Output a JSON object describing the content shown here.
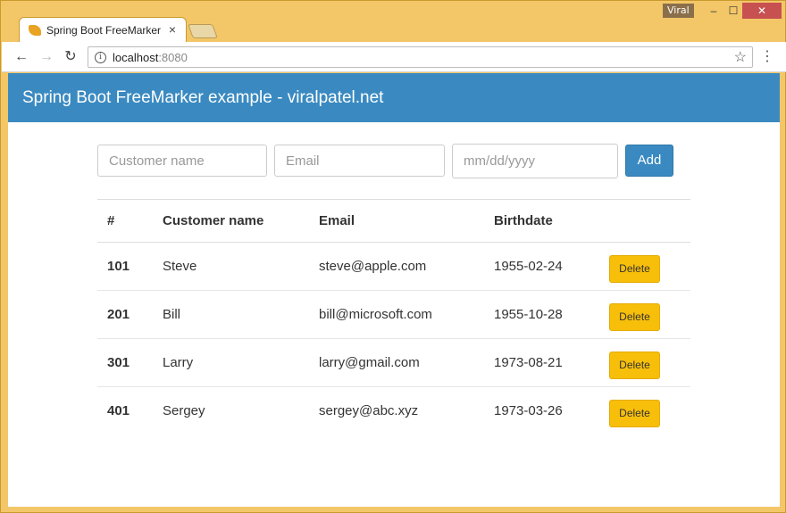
{
  "browser": {
    "profile_name": "Viral",
    "tab_title": "Spring Boot FreeMarker",
    "tab_close": "×",
    "url_host": "localhost",
    "url_port": ":8080",
    "window_controls": {
      "minimize": "‒",
      "maximize": "☐",
      "close": "✕"
    },
    "nav": {
      "back": "←",
      "forward": "→",
      "reload": "↻"
    },
    "star": "☆",
    "menu": "⋮",
    "info": "i"
  },
  "header": {
    "title": "Spring Boot FreeMarker example - viralpatel.net",
    "color": "#3a8ac1"
  },
  "form": {
    "name_placeholder": "Customer name",
    "email_placeholder": "Email",
    "date_placeholder": "mm/dd/yyyy",
    "add_label": "Add"
  },
  "table": {
    "columns": [
      "#",
      "Customer name",
      "Email",
      "Birthdate"
    ],
    "rows": [
      {
        "id": "101",
        "name": "Steve",
        "email": "steve@apple.com",
        "birthdate": "1955-02-24",
        "action": "Delete"
      },
      {
        "id": "201",
        "name": "Bill",
        "email": "bill@microsoft.com",
        "birthdate": "1955-10-28",
        "action": "Delete"
      },
      {
        "id": "301",
        "name": "Larry",
        "email": "larry@gmail.com",
        "birthdate": "1973-08-21",
        "action": "Delete"
      },
      {
        "id": "401",
        "name": "Sergey",
        "email": "sergey@abc.xyz",
        "birthdate": "1973-03-26",
        "action": "Delete"
      }
    ]
  },
  "colors": {
    "accent": "#3a8ac1",
    "delete_button": "#f7bf09",
    "window_frame": "#f3c768"
  }
}
